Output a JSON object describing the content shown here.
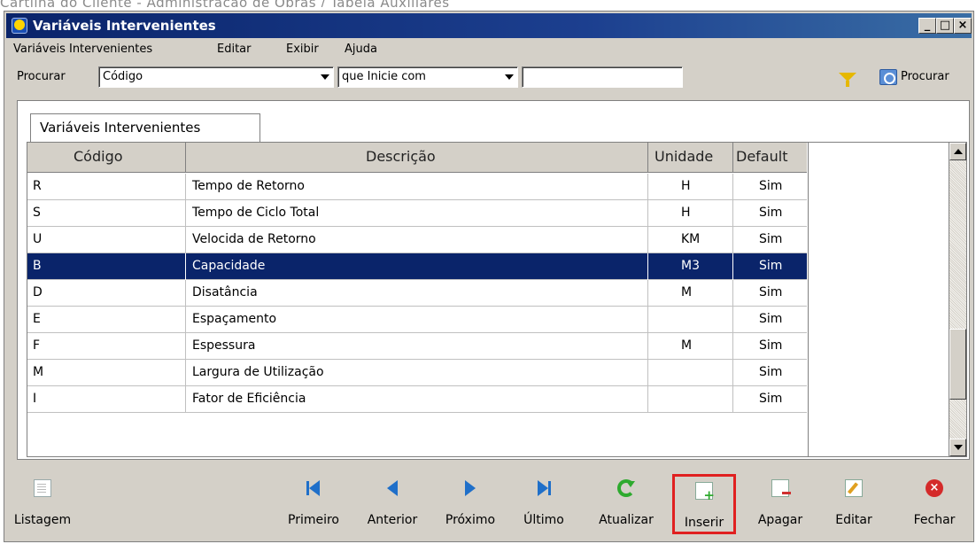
{
  "caption": "Cartilha do Cliente - Administração de Obras / Tabela Auxiliares",
  "window": {
    "title": "Variáveis Intervenientes",
    "controls": {
      "minimize": "_",
      "maximize": "□",
      "close": "×"
    }
  },
  "menu": [
    "Variáveis Intervenientes",
    "Editar",
    "Exibir",
    "Ajuda"
  ],
  "search": {
    "label": "Procurar",
    "field_value": "Código",
    "condition_value": "que Inicie com",
    "text_value": "",
    "button_label": "Procurar"
  },
  "tab": {
    "label": "Variáveis Intervenientes"
  },
  "grid": {
    "columns": [
      "Código",
      "Descrição",
      "Unidade",
      "Default"
    ],
    "rows": [
      {
        "codigo": "R",
        "descricao": "Tempo de Retorno",
        "unidade": "H",
        "default": "Sim"
      },
      {
        "codigo": "S",
        "descricao": "Tempo de Ciclo Total",
        "unidade": "H",
        "default": "Sim"
      },
      {
        "codigo": "U",
        "descricao": "Velocida de Retorno",
        "unidade": "KM",
        "default": "Sim"
      },
      {
        "codigo": "B",
        "descricao": "Capacidade",
        "unidade": "M3",
        "default": "Sim"
      },
      {
        "codigo": "D",
        "descricao": "Disatância",
        "unidade": "M",
        "default": "Sim"
      },
      {
        "codigo": "E",
        "descricao": "Espaçamento",
        "unidade": "",
        "default": "Sim"
      },
      {
        "codigo": "F",
        "descricao": "Espessura",
        "unidade": "M",
        "default": "Sim"
      },
      {
        "codigo": "M",
        "descricao": "Largura de Utilização",
        "unidade": "",
        "default": "Sim"
      },
      {
        "codigo": "I",
        "descricao": "Fator de Eficiência",
        "unidade": "",
        "default": "Sim"
      }
    ],
    "selected_index": 3
  },
  "toolbar": [
    {
      "name": "listagem",
      "label": "Listagem",
      "icon": "document-icon"
    },
    {
      "name": "primeiro",
      "label": "Primeiro",
      "icon": "first-icon"
    },
    {
      "name": "anterior",
      "label": "Anterior",
      "icon": "previous-icon"
    },
    {
      "name": "proximo",
      "label": "Próximo",
      "icon": "next-icon"
    },
    {
      "name": "ultimo",
      "label": "Último",
      "icon": "last-icon"
    },
    {
      "name": "atualizar",
      "label": "Atualizar",
      "icon": "refresh-icon"
    },
    {
      "name": "inserir",
      "label": "Inserir",
      "icon": "insert-icon"
    },
    {
      "name": "apagar",
      "label": "Apagar",
      "icon": "delete-icon"
    },
    {
      "name": "editar",
      "label": "Editar",
      "icon": "edit-icon"
    },
    {
      "name": "fechar",
      "label": "Fechar",
      "icon": "close-icon"
    }
  ],
  "colors": {
    "selection": "#0a246a",
    "titlebar": "#0a246a",
    "highlight_border": "#e02020"
  }
}
